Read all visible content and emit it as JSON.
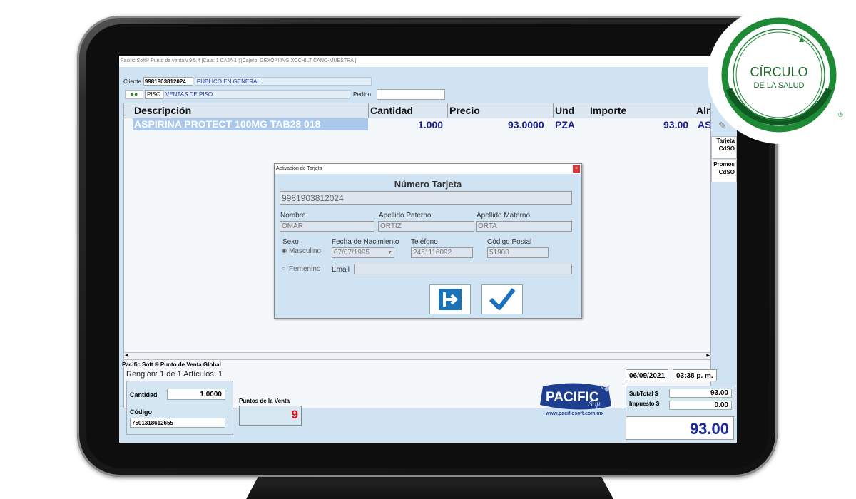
{
  "window": {
    "title": "Pacific Soft® Punto de venta  v.9.5.4     [Caja:  1  CAJA 1  ]    [Cajero:  GEXOPI  ING XOCHILT CANO-MUESTRA  ]"
  },
  "client": {
    "label": "Cliente",
    "number": "9981903812024",
    "name": "PUBLICO EN GENERAL"
  },
  "piso": {
    "code": "PISO",
    "name": "VENTAS DE PISO",
    "pedido_label": "Pedido",
    "pedido_value": ""
  },
  "grid": {
    "headers": [
      "Descripción",
      "Cantidad",
      "Precio",
      "Und",
      "Importe",
      "Alm"
    ],
    "rows": [
      {
        "descripcion": "ASPIRINA PROTECT 100MG TAB28 018",
        "cantidad": "1.000",
        "precio": "93.0000",
        "und": "PZA",
        "importe": "93.00",
        "alm": "AS"
      }
    ]
  },
  "sidebar": {
    "tarjeta_label": "Tarjeta CdSO",
    "promos_label": "Promos CdSO"
  },
  "status": {
    "title": "Pacific Soft ® Punto de Venta Global",
    "renglon": "Renglón: 1 de 1   Artículos: 1"
  },
  "entry": {
    "cantidad_label": "Cantidad",
    "cantidad_value": "1.0000",
    "codigo_label": "Código",
    "codigo_value": "7501318612655"
  },
  "points": {
    "label": "Puntos de la Venta",
    "value": "9"
  },
  "brand": {
    "logo_text": "PACIFIC",
    "logo_sub": "Soft",
    "url": "www.pacificsoft.com.mx"
  },
  "datetime": {
    "date": "06/09/2021",
    "time": "03:38 p. m."
  },
  "totals": {
    "subtotal_label": "SubTotal $",
    "subtotal_value": "93.00",
    "impuesto_label": "Impuesto $",
    "impuesto_value": "0.00",
    "total_value": "93.00"
  },
  "dialog": {
    "title": "Activación de Tarjeta",
    "heading": "Número Tarjeta",
    "card_number": "9981903812024",
    "nombre_label": "Nombre",
    "nombre_value": "OMAR",
    "paterno_label": "Apellido Paterno",
    "paterno_value": "ORTIZ",
    "materno_label": "Apellido Materno",
    "materno_value": "ORTA",
    "sexo_label": "Sexo",
    "masculino_label": "Masculino",
    "femenino_label": "Femenino",
    "fecha_label": "Fecha de Nacimiento",
    "fecha_value": "07/07/1995",
    "telefono_label": "Teléfono",
    "telefono_value": "2451116092",
    "cp_label": "Código Postal",
    "cp_value": "51900",
    "email_label": "Email",
    "email_value": ""
  },
  "logo": {
    "line1": "CÍRCULO",
    "line2": "DE LA SALUD",
    "mark": "®"
  },
  "colors": {
    "screen_bg": "#cfe3f2",
    "selected_row": "#a9c8ec",
    "accent_blue": "#1a2aa0",
    "logo_green": "#1f8a36",
    "points_red": "#e01010"
  }
}
